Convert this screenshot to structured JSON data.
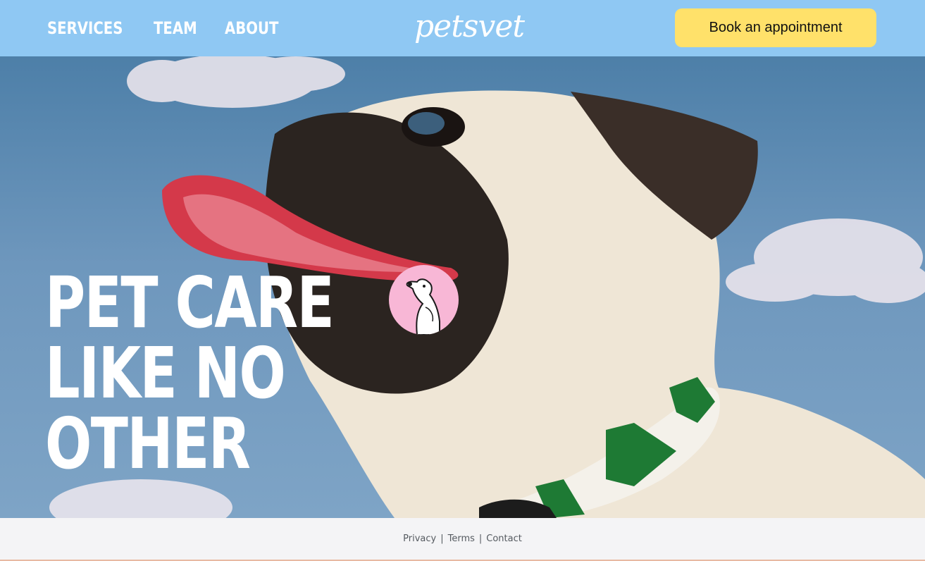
{
  "nav": {
    "links": [
      "SERVICES",
      "TEAM",
      "ABOUT"
    ],
    "logo": "petsvet",
    "cta_label": "Book an appointment"
  },
  "hero": {
    "title_lines": [
      "PET CARE",
      "LIKE NO",
      "OTHER"
    ],
    "badge_icon": "poodle-icon"
  },
  "footer": {
    "links": [
      "Privacy",
      "Terms",
      "Contact"
    ],
    "separator": "|"
  },
  "colors": {
    "nav_bg": "#8fc8f3",
    "cta_bg": "#ffe16a",
    "badge_bg": "#f8b7d6",
    "footer_bg": "#f4f4f6"
  }
}
